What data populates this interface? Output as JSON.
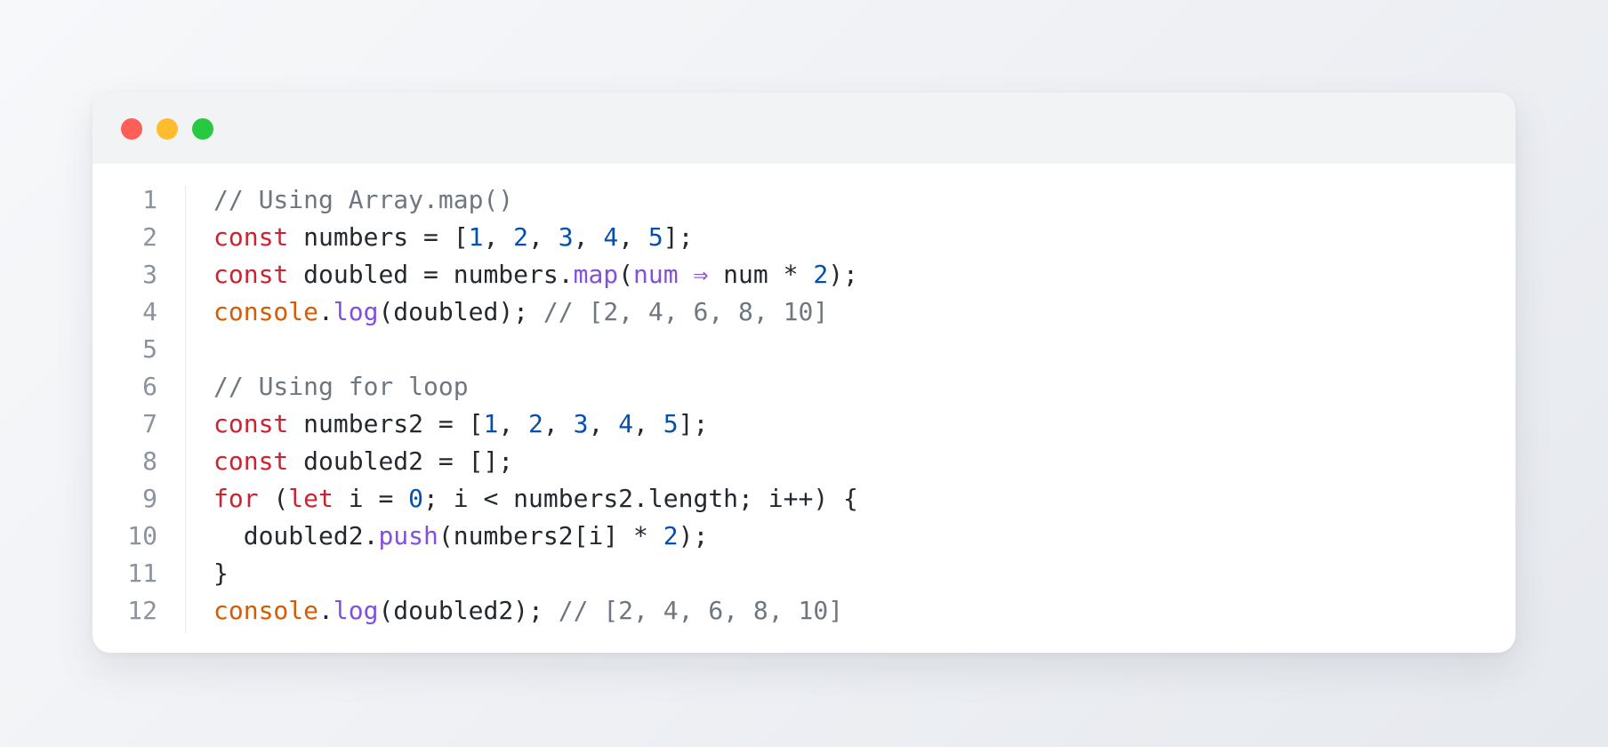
{
  "window": {
    "controls": [
      {
        "name": "close",
        "color": "#ff5f57"
      },
      {
        "name": "minimize",
        "color": "#febc2e"
      },
      {
        "name": "maximize",
        "color": "#28c840"
      }
    ]
  },
  "code": {
    "lines": [
      {
        "number": "1",
        "tokens": [
          {
            "t": "// Using Array.map()",
            "k": "comment"
          }
        ]
      },
      {
        "number": "2",
        "tokens": [
          {
            "t": "const",
            "k": "keyword"
          },
          {
            "t": " numbers = [",
            "k": "plain"
          },
          {
            "t": "1",
            "k": "number"
          },
          {
            "t": ", ",
            "k": "plain"
          },
          {
            "t": "2",
            "k": "number"
          },
          {
            "t": ", ",
            "k": "plain"
          },
          {
            "t": "3",
            "k": "number"
          },
          {
            "t": ", ",
            "k": "plain"
          },
          {
            "t": "4",
            "k": "number"
          },
          {
            "t": ", ",
            "k": "plain"
          },
          {
            "t": "5",
            "k": "number"
          },
          {
            "t": "];",
            "k": "plain"
          }
        ]
      },
      {
        "number": "3",
        "tokens": [
          {
            "t": "const",
            "k": "keyword"
          },
          {
            "t": " doubled = numbers.",
            "k": "plain"
          },
          {
            "t": "map",
            "k": "func"
          },
          {
            "t": "(",
            "k": "plain"
          },
          {
            "t": "num",
            "k": "param"
          },
          {
            "t": " ",
            "k": "plain"
          },
          {
            "t": "⇒",
            "k": "arrow"
          },
          {
            "t": " num * ",
            "k": "plain"
          },
          {
            "t": "2",
            "k": "number"
          },
          {
            "t": ");",
            "k": "plain"
          }
        ]
      },
      {
        "number": "4",
        "tokens": [
          {
            "t": "console",
            "k": "builtin"
          },
          {
            "t": ".",
            "k": "plain"
          },
          {
            "t": "log",
            "k": "func"
          },
          {
            "t": "(doubled); ",
            "k": "plain"
          },
          {
            "t": "// [2, 4, 6, 8, 10]",
            "k": "comment"
          }
        ]
      },
      {
        "number": "5",
        "tokens": []
      },
      {
        "number": "6",
        "tokens": [
          {
            "t": "// Using for loop",
            "k": "comment"
          }
        ]
      },
      {
        "number": "7",
        "tokens": [
          {
            "t": "const",
            "k": "keyword"
          },
          {
            "t": " numbers2 = [",
            "k": "plain"
          },
          {
            "t": "1",
            "k": "number"
          },
          {
            "t": ", ",
            "k": "plain"
          },
          {
            "t": "2",
            "k": "number"
          },
          {
            "t": ", ",
            "k": "plain"
          },
          {
            "t": "3",
            "k": "number"
          },
          {
            "t": ", ",
            "k": "plain"
          },
          {
            "t": "4",
            "k": "number"
          },
          {
            "t": ", ",
            "k": "plain"
          },
          {
            "t": "5",
            "k": "number"
          },
          {
            "t": "];",
            "k": "plain"
          }
        ]
      },
      {
        "number": "8",
        "tokens": [
          {
            "t": "const",
            "k": "keyword"
          },
          {
            "t": " doubled2 = [];",
            "k": "plain"
          }
        ]
      },
      {
        "number": "9",
        "tokens": [
          {
            "t": "for",
            "k": "keyword"
          },
          {
            "t": " (",
            "k": "plain"
          },
          {
            "t": "let",
            "k": "keyword"
          },
          {
            "t": " i = ",
            "k": "plain"
          },
          {
            "t": "0",
            "k": "number"
          },
          {
            "t": "; i < numbers2.length; i++) {",
            "k": "plain"
          }
        ]
      },
      {
        "number": "10",
        "tokens": [
          {
            "t": "  doubled2.",
            "k": "plain"
          },
          {
            "t": "push",
            "k": "func"
          },
          {
            "t": "(numbers2[i] * ",
            "k": "plain"
          },
          {
            "t": "2",
            "k": "number"
          },
          {
            "t": ");",
            "k": "plain"
          }
        ]
      },
      {
        "number": "11",
        "tokens": [
          {
            "t": "}",
            "k": "plain"
          }
        ]
      },
      {
        "number": "12",
        "tokens": [
          {
            "t": "console",
            "k": "builtin"
          },
          {
            "t": ".",
            "k": "plain"
          },
          {
            "t": "log",
            "k": "func"
          },
          {
            "t": "(doubled2); ",
            "k": "plain"
          },
          {
            "t": "// [2, 4, 6, 8, 10]",
            "k": "comment"
          }
        ]
      }
    ]
  }
}
